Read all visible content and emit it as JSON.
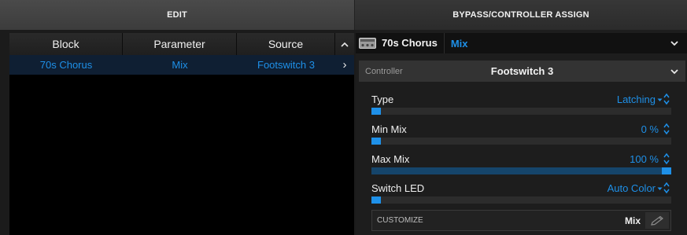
{
  "tabs": {
    "edit": "EDIT",
    "bypass": "BYPASS/CONTROLLER ASSIGN"
  },
  "table": {
    "headers": {
      "block": "Block",
      "parameter": "Parameter",
      "source": "Source",
      "sort_icon": "caret-up-icon"
    },
    "rows": [
      {
        "block": "70s Chorus",
        "parameter": "Mix",
        "source": "Footswitch 3",
        "chevron": "›"
      }
    ]
  },
  "assign": {
    "block_name": "70s Chorus",
    "parameter_name": "Mix",
    "controller_label": "Controller",
    "controller_value": "Footswitch 3",
    "params": [
      {
        "label": "Type",
        "value": "Latching",
        "dropdown": true,
        "level": 0.0
      },
      {
        "label": "Min Mix",
        "value": "0 %",
        "dropdown": false,
        "level": 0.0
      },
      {
        "label": "Max Mix",
        "value": "100 %",
        "dropdown": false,
        "level": 1.0
      },
      {
        "label": "Switch LED",
        "value": "Auto Color",
        "dropdown": true,
        "level": 0.0
      }
    ],
    "customize_label": "CUSTOMIZE",
    "customize_value": "Mix"
  },
  "colors": {
    "accent": "#1e90e8",
    "fill": "#15456b",
    "selected_row": "#0f1f33"
  },
  "icons": {
    "block_icon": "pedal-icon",
    "edit_icon": "pencil-icon",
    "dropdown": "chevron-down-icon",
    "stepper": "stepper-icon"
  }
}
